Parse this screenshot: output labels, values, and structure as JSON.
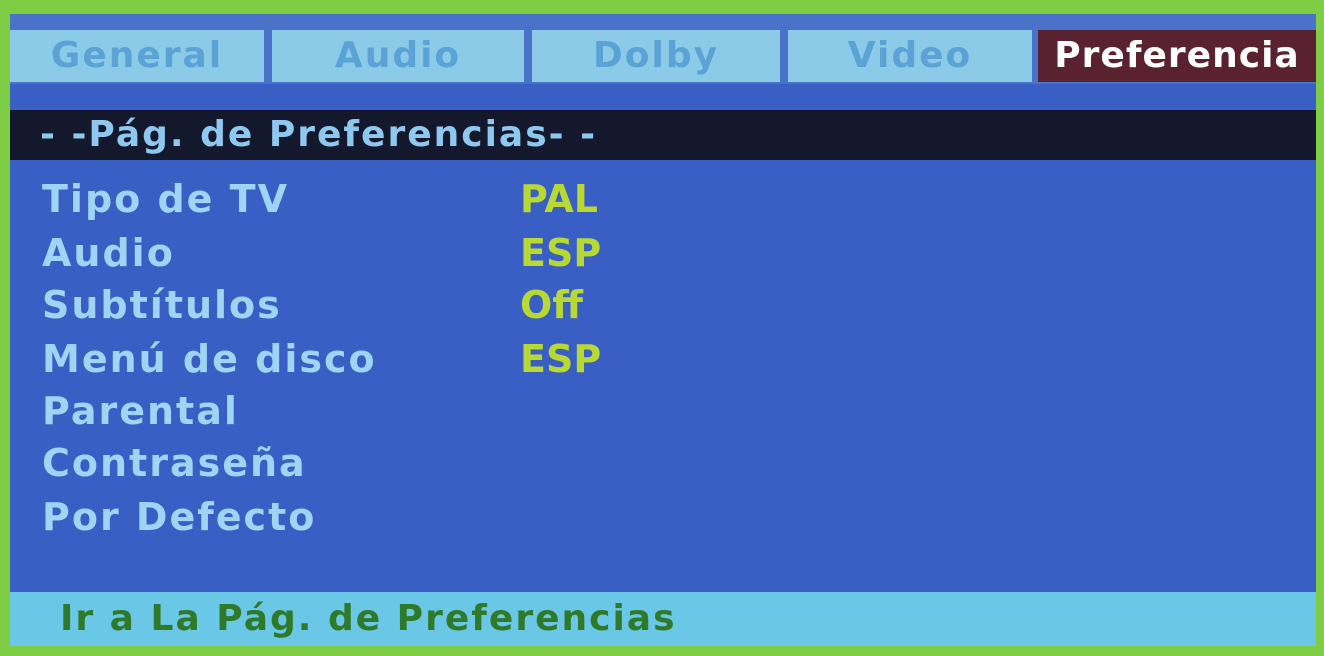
{
  "tabs": [
    {
      "label": "General"
    },
    {
      "label": "Audio"
    },
    {
      "label": "Dolby"
    },
    {
      "label": "Video"
    },
    {
      "label": "Preferencia",
      "active": true
    }
  ],
  "page_title": "- -Pág. de Preferencias- -",
  "menu": [
    {
      "label": "Tipo de TV",
      "value": "PAL"
    },
    {
      "label": "Audio",
      "value": "ESP"
    },
    {
      "label": "Subtítulos",
      "value": "Off"
    },
    {
      "label": "Menú de disco",
      "value": "ESP"
    },
    {
      "label": "Parental",
      "value": ""
    },
    {
      "label": "Contraseña",
      "value": ""
    },
    {
      "label": "Por Defecto",
      "value": ""
    }
  ],
  "status": "Ir a La Pág. de Preferencias",
  "colors": {
    "background_border": "#7fcc45",
    "panel": "#3a5fc4",
    "tab_inactive": "#8ccbe8",
    "tab_active": "#5a2230",
    "title_strip": "#13182c",
    "label_text": "#9fd4f4",
    "value_text": "#b8d834",
    "status_bar": "#6ac8e6",
    "status_text": "#2f7a2a"
  }
}
